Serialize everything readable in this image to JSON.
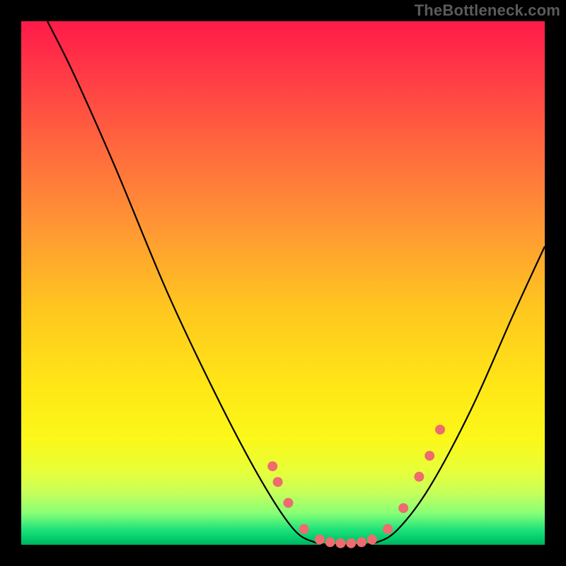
{
  "watermark": "TheBottleneck.com",
  "chart_data": {
    "type": "line",
    "title": "",
    "xlabel": "",
    "ylabel": "",
    "xlim": [
      0,
      100
    ],
    "ylim": [
      0,
      100
    ],
    "curve": {
      "comment": "V-shaped bottleneck curve. x in 0..100 across plot, y is 0 at bottom, 100 at top.",
      "points": [
        {
          "x": 5,
          "y": 100
        },
        {
          "x": 10,
          "y": 90
        },
        {
          "x": 18,
          "y": 72
        },
        {
          "x": 28,
          "y": 48
        },
        {
          "x": 38,
          "y": 27
        },
        {
          "x": 46,
          "y": 12
        },
        {
          "x": 52,
          "y": 3
        },
        {
          "x": 56,
          "y": 0.5
        },
        {
          "x": 60,
          "y": 0
        },
        {
          "x": 64,
          "y": 0
        },
        {
          "x": 68,
          "y": 0.5
        },
        {
          "x": 72,
          "y": 3
        },
        {
          "x": 78,
          "y": 11
        },
        {
          "x": 86,
          "y": 26
        },
        {
          "x": 94,
          "y": 44
        },
        {
          "x": 100,
          "y": 57
        }
      ]
    },
    "markers": {
      "comment": "Pink-red marker dots clustered around the valley and lower arms.",
      "color": "#ef6b6f",
      "radius": 7,
      "points": [
        {
          "x": 48,
          "y": 15
        },
        {
          "x": 49,
          "y": 12
        },
        {
          "x": 51,
          "y": 8
        },
        {
          "x": 54,
          "y": 3
        },
        {
          "x": 57,
          "y": 1
        },
        {
          "x": 59,
          "y": 0.5
        },
        {
          "x": 61,
          "y": 0.3
        },
        {
          "x": 63,
          "y": 0.3
        },
        {
          "x": 65,
          "y": 0.5
        },
        {
          "x": 67,
          "y": 1
        },
        {
          "x": 70,
          "y": 3
        },
        {
          "x": 73,
          "y": 7
        },
        {
          "x": 76,
          "y": 13
        },
        {
          "x": 78,
          "y": 17
        },
        {
          "x": 80,
          "y": 22
        }
      ]
    }
  }
}
